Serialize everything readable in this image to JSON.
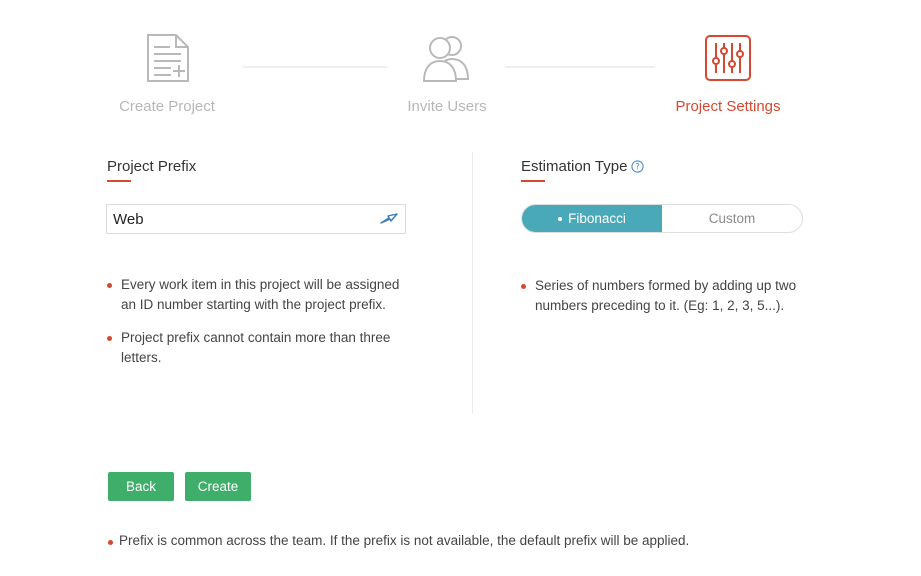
{
  "stepper": {
    "steps": [
      {
        "label": "Create Project",
        "icon": "document-icon",
        "state": "done"
      },
      {
        "label": "Invite Users",
        "icon": "users-icon",
        "state": "done"
      },
      {
        "label": "Project Settings",
        "icon": "sliders-icon",
        "state": "active"
      }
    ]
  },
  "prefix": {
    "title": "Project Prefix",
    "value": "Web",
    "bullets": [
      "Every work item in this project will be assigned an ID number starting with the project prefix.",
      "Project prefix cannot contain more than three letters."
    ]
  },
  "estimation": {
    "title": "Estimation Type",
    "options": [
      "Fibonacci",
      "Custom"
    ],
    "selected": "Fibonacci",
    "bullets": [
      "Series of numbers formed by adding up two numbers preceding to it. (Eg: 1, 2, 3, 5...)."
    ]
  },
  "actions": {
    "back_label": "Back",
    "create_label": "Create"
  },
  "footnote": "Prefix is common across the team. If the prefix is not available, the default prefix will be applied.",
  "colors": {
    "accent": "#d8472f",
    "toggle_active": "#4aa9b8",
    "button": "#3fae6b",
    "inactive_text": "#b7b7b7"
  }
}
